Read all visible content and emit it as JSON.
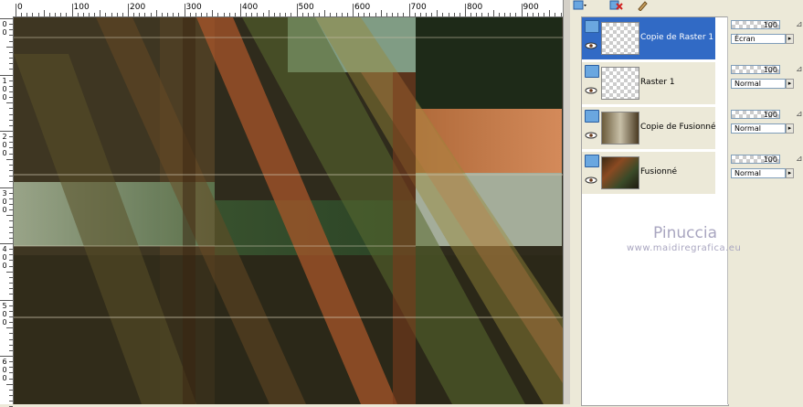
{
  "ruler": {
    "top_labels": [
      "0",
      "100",
      "200",
      "300",
      "400",
      "500",
      "600",
      "700",
      "800",
      "900"
    ],
    "left_labels": [
      [
        "0",
        "0"
      ],
      [
        "1",
        "0",
        "0"
      ],
      [
        "2",
        "0",
        "0"
      ],
      [
        "3",
        "0",
        "0"
      ],
      [
        "4",
        "0",
        "0"
      ],
      [
        "5",
        "0",
        "0"
      ],
      [
        "6",
        "0",
        "0"
      ]
    ]
  },
  "layers": [
    {
      "name": "Copie de Raster 1",
      "selected": true,
      "thumb": "checker"
    },
    {
      "name": "Raster 1",
      "selected": false,
      "thumb": "checker"
    },
    {
      "name": "Copie de Fusionné",
      "selected": false,
      "thumb": "image"
    },
    {
      "name": "Fusionné",
      "selected": false,
      "thumb": "image"
    }
  ],
  "properties": [
    {
      "opacity": "100",
      "blend": "Écran"
    },
    {
      "opacity": "100",
      "blend": "Normal"
    },
    {
      "opacity": "100",
      "blend": "Normal"
    },
    {
      "opacity": "100",
      "blend": "Normal"
    }
  ],
  "watermark": {
    "title": "Pinuccia",
    "url": "www.maidiregrafica.eu"
  },
  "colors": {
    "selection": "#316ac5",
    "panel_bg": "#ece9d8",
    "accent_blue": "#3a66c8"
  }
}
